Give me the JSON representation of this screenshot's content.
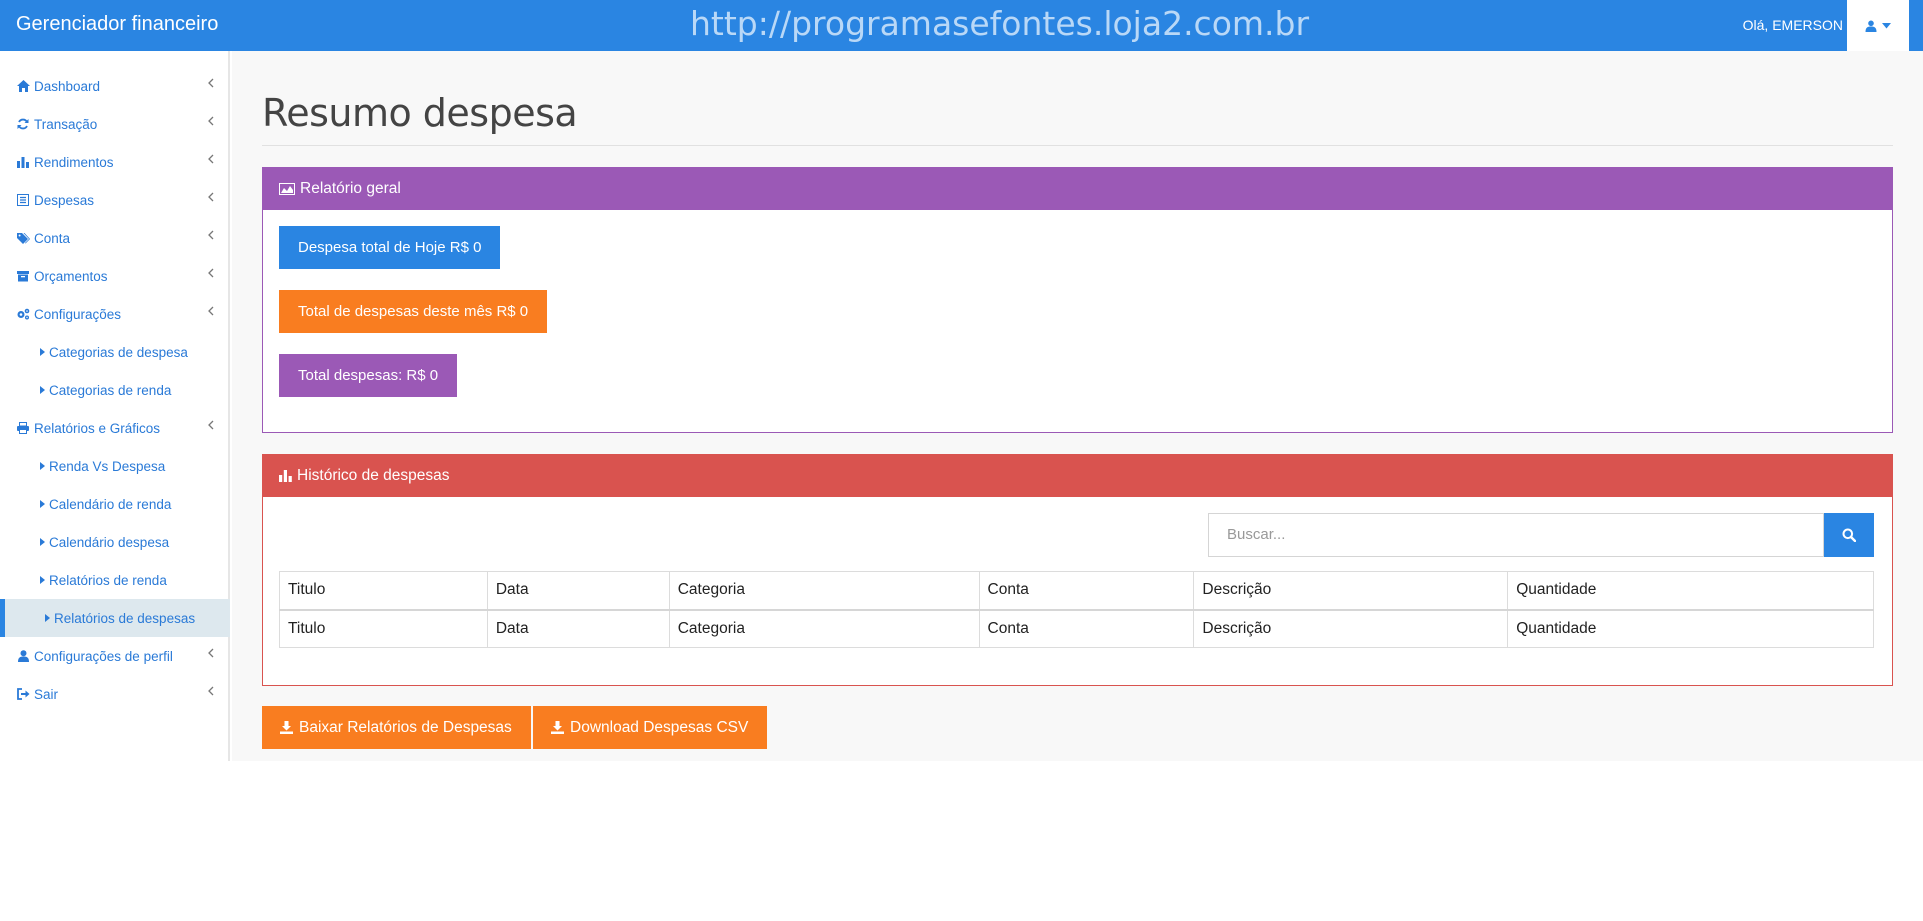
{
  "header": {
    "brand": "Gerenciador financeiro",
    "watermark": "http://programasefontes.loja2.com.br",
    "greeting": "Olá, EMERSON"
  },
  "sidebar": {
    "items": [
      {
        "label": "Dashboard",
        "icon": "home-icon"
      },
      {
        "label": "Transação",
        "icon": "refresh-icon"
      },
      {
        "label": "Rendimentos",
        "icon": "bar-chart-icon"
      },
      {
        "label": "Despesas",
        "icon": "list-icon"
      },
      {
        "label": "Conta",
        "icon": "tags-icon"
      },
      {
        "label": "Orçamentos",
        "icon": "archive-icon"
      },
      {
        "label": "Configurações",
        "icon": "gears-icon"
      },
      {
        "label": "Categorias de despesa",
        "icon": "caret-right-icon"
      },
      {
        "label": "Categorias de renda",
        "icon": "caret-right-icon"
      },
      {
        "label": "Relatórios e Gráficos",
        "icon": "print-icon"
      },
      {
        "label": "Renda Vs Despesa",
        "icon": "caret-right-icon"
      },
      {
        "label": "Calendário de renda",
        "icon": "caret-right-icon"
      },
      {
        "label": "Calendário despesa",
        "icon": "caret-right-icon"
      },
      {
        "label": "Relatórios de renda",
        "icon": "caret-right-icon"
      },
      {
        "label": "Relatórios de despesas",
        "icon": "caret-right-icon"
      },
      {
        "label": "Configurações de perfil",
        "icon": "user-icon"
      },
      {
        "label": "Sair",
        "icon": "sign-out-icon"
      }
    ]
  },
  "main": {
    "title": "Resumo despesa",
    "report_panel": {
      "title": "Relatório geral",
      "stats": [
        "Despesa total de Hoje R$ 0",
        "Total de despesas deste mês R$ 0",
        "Total despesas: R$ 0"
      ]
    },
    "history_panel": {
      "title": "Histórico de despesas",
      "search_placeholder": "Buscar...",
      "columns": [
        "Titulo",
        "Data",
        "Categoria",
        "Conta",
        "Descrição",
        "Quantidade"
      ],
      "footer": [
        "Titulo",
        "Data",
        "Categoria",
        "Conta",
        "Descrição",
        "Quantidade"
      ]
    },
    "buttons": {
      "download_reports": "Baixar Relatórios de Despesas",
      "download_csv": "Download Despesas CSV"
    }
  },
  "colors": {
    "primary": "#2a85e2",
    "purple": "#9b59b6",
    "orange": "#f97d20",
    "red": "#d9534f"
  }
}
